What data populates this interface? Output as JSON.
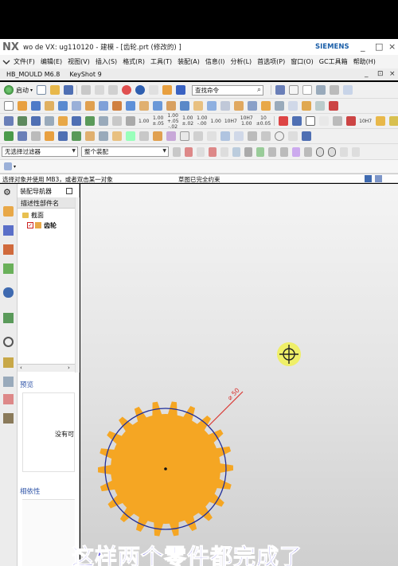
{
  "window": {
    "app_logo": "NX",
    "title": "wo de VX:  ug110120 - 建模 - [齿轮.prt  (修改的) ]",
    "brand": "SIEMENS",
    "controls": [
      "_",
      "□",
      "×"
    ]
  },
  "menu": {
    "items": [
      "文件(F)",
      "编辑(E)",
      "视图(V)",
      "插入(S)",
      "格式(R)",
      "工具(T)",
      "装配(A)",
      "信息(I)",
      "分析(L)",
      "首选项(P)",
      "窗口(O)",
      "GC工具箱",
      "帮助(H)"
    ]
  },
  "tabs": {
    "items": [
      "HB_MOULD M6.8",
      "KeyShot 9"
    ],
    "controls": [
      "_",
      "⊡",
      "×"
    ]
  },
  "toolbar": {
    "start_label": "启动",
    "search_placeholder": "查找命令",
    "dim_labels": [
      "1.00",
      "1.00\n±.05",
      "1.00\n+.05\n-.02",
      "1.00\n±.02",
      "1.00\n-.00",
      "1.00",
      "10H7",
      "10H7\n1.00",
      "10\n±0.05"
    ],
    "dim_labels_row2": [
      "10H7"
    ],
    "filter_label": "无选择过滤器",
    "assembly_scope": "整个装配"
  },
  "status": {
    "prompt": "选择对象并使用 MB3，或者双击某一对象",
    "message": "草图已完全约束"
  },
  "assembly_navigator": {
    "title": "装配导航器",
    "column": "描述性部件名",
    "nodes": [
      {
        "label": "截面",
        "icon": "folder-icon"
      },
      {
        "label": "齿轮",
        "icon": "part-icon",
        "checked": true
      }
    ],
    "preview_title": "预览",
    "preview_text": "没有可",
    "dependency_title": "相依性"
  },
  "viewport": {
    "dimension_label": "⌀ 50",
    "gear_color": "#f5a623",
    "circle_color": "#1f2e9b",
    "dimension_color": "#d9302c",
    "gear_teeth": 22
  },
  "subtitle": "这样两个零件都完成了"
}
